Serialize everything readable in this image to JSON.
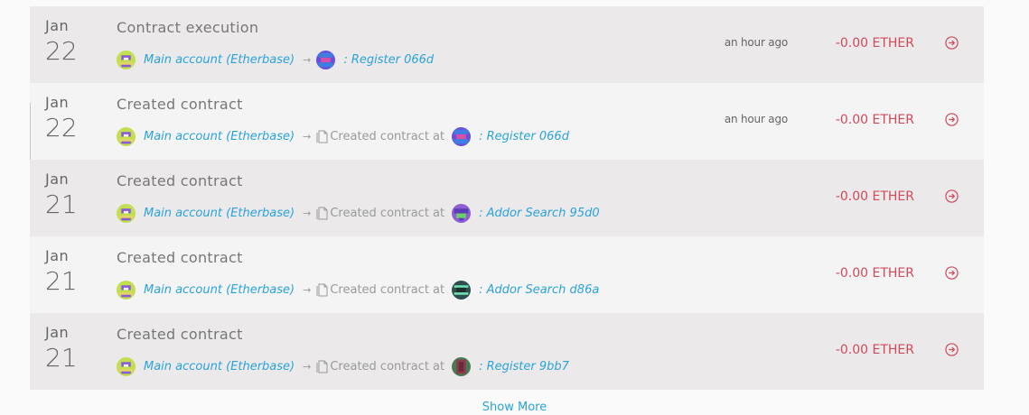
{
  "transactions": [
    {
      "month": "Jan",
      "day": "22",
      "title": "Contract execution",
      "from": "Main account (Etherbase)",
      "created_label": "",
      "target": ": Register 066d",
      "time": "an hour ago",
      "amount": "-0.00 ETHER"
    },
    {
      "month": "Jan",
      "day": "22",
      "title": "Created contract",
      "from": "Main account (Etherbase)",
      "created_label": "Created contract at",
      "target": ": Register 066d",
      "time": "an hour ago",
      "amount": "-0.00 ETHER"
    },
    {
      "month": "Jan",
      "day": "21",
      "title": "Created contract",
      "from": "Main account (Etherbase)",
      "created_label": "Created contract at",
      "target": ": Addor Search 95d0",
      "time": "",
      "amount": "-0.00 ETHER"
    },
    {
      "month": "Jan",
      "day": "21",
      "title": "Created contract",
      "from": "Main account (Etherbase)",
      "created_label": "Created contract at",
      "target": ": Addor Search d86a",
      "time": "",
      "amount": "-0.00 ETHER"
    },
    {
      "month": "Jan",
      "day": "21",
      "title": "Created contract",
      "from": "Main account (Etherbase)",
      "created_label": "Created contract at",
      "target": ": Register 9bb7",
      "time": "",
      "amount": "-0.00 ETHER"
    }
  ],
  "show_more_label": "Show More",
  "colors": {
    "link": "#2aa3db",
    "amount": "#d14a5a",
    "row_shaded": "#ebe9ea",
    "row_light": "#f5f4f5"
  },
  "icons": {
    "avatar": "identicon-avatar",
    "arrow": "right-arrow-icon",
    "document": "document-icon",
    "go": "arrow-circle-right-icon"
  }
}
